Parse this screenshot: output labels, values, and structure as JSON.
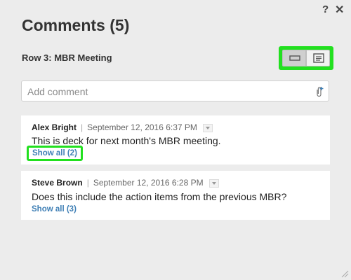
{
  "header": {
    "help_label": "?",
    "close_label": "✕",
    "title": "Comments (5)",
    "row_label": "Row 3:  MBR Meeting"
  },
  "view_toggle": {
    "left_icon": "collapsed-view-icon",
    "right_icon": "expanded-view-icon",
    "highlight_color": "#22e01f"
  },
  "add_comment": {
    "placeholder": "Add comment",
    "value": "",
    "attach_icon": "paperclip-add-icon"
  },
  "comments": [
    {
      "author": "Alex Bright",
      "separator": "|",
      "date": "September 12, 2016 6:37 PM",
      "text": "This is deck for next month's MBR meeting.",
      "show_all": "Show all (2)"
    },
    {
      "author": "Steve Brown",
      "separator": "|",
      "date": "September 12, 2016 6:28 PM",
      "text": "Does this include the action items from the previous MBR?",
      "show_all": "Show all (3)"
    }
  ],
  "colors": {
    "link": "#3f7fb5",
    "background": "#ececec"
  }
}
